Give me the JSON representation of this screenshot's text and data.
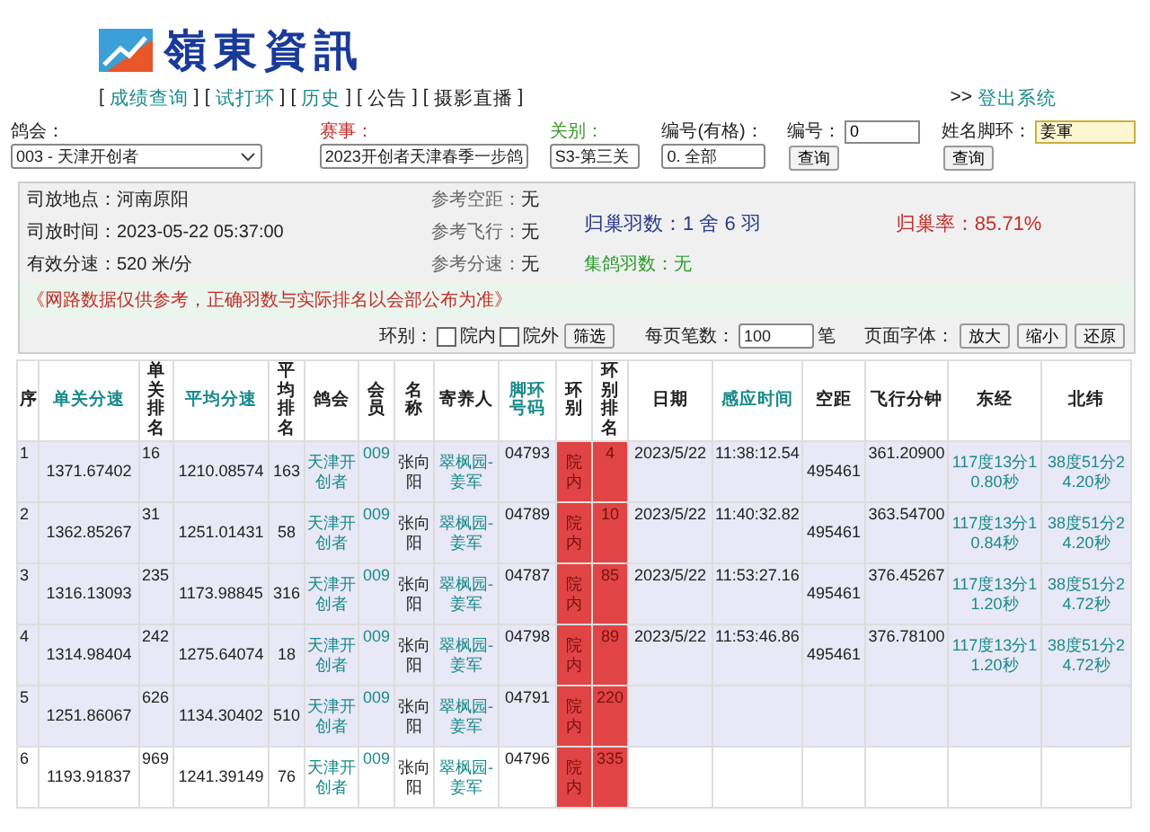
{
  "header": {
    "logo_text": "嶺東資訊"
  },
  "nav": {
    "bracket_open": "[",
    "bracket_close": "]",
    "items": [
      {
        "label": "成绩查询",
        "kind": "link"
      },
      {
        "label": "试打环",
        "kind": "link"
      },
      {
        "label": "历史",
        "kind": "link"
      },
      {
        "label": "公告",
        "kind": "text"
      },
      {
        "label": "摄影直播",
        "kind": "text"
      }
    ]
  },
  "logout": {
    "prefix": ">>",
    "label": "登出系统"
  },
  "filters": {
    "club": {
      "label": "鸽会：",
      "value": "003 - 天津开创者"
    },
    "race": {
      "label": "赛事：",
      "value": "2023开创者天津春季一步鸽"
    },
    "stage": {
      "label": "关别：",
      "value": "S3-第三关"
    },
    "group": {
      "label": "编号(有格)：",
      "value": "0. 全部"
    },
    "number": {
      "label": "编号：",
      "value": "0",
      "button": "查询"
    },
    "name_ring": {
      "label": "姓名脚环：",
      "value": "姜軍",
      "button": "查询"
    }
  },
  "info": {
    "place": {
      "label": "司放地点：",
      "value": "河南原阳"
    },
    "time": {
      "label": "司放时间：",
      "value": "2023-05-22 05:37:00"
    },
    "speed": {
      "label": "有效分速：",
      "value": "520 米/分"
    },
    "ref_distance": {
      "label": "参考空距：",
      "value": "无"
    },
    "ref_flight": {
      "label": "参考飞行：",
      "value": "无"
    },
    "ref_speed": {
      "label": "参考分速：",
      "value": "无"
    },
    "returned": {
      "label": "归巢羽数：",
      "value": "1 舍 6 羽"
    },
    "return_rate": {
      "label": "归巢率：",
      "value": "85.71%"
    },
    "collected": {
      "label": "集鸽羽数：",
      "value": "无"
    },
    "notice": "《网路数据仅供参考，正确羽数与实际排名以会部公布为准》"
  },
  "controls": {
    "ring_label": "环别：",
    "inside": {
      "label": "院内",
      "checked": false
    },
    "outside": {
      "label": "院外",
      "checked": false
    },
    "filter_button": "筛选",
    "per_page_label": "每页笔数：",
    "per_page": "100",
    "per_page_unit": "笔",
    "font_label": "页面字体：",
    "font_buttons": [
      "放大",
      "缩小",
      "还原"
    ]
  },
  "table": {
    "columns": [
      {
        "label": "序",
        "sortable": false
      },
      {
        "label": "单关分速",
        "sortable": true
      },
      {
        "label": "单关排名",
        "sortable": false
      },
      {
        "label": "平均分速",
        "sortable": true
      },
      {
        "label": "平均排名",
        "sortable": false
      },
      {
        "label": "鸽会",
        "sortable": false
      },
      {
        "label": "会员",
        "sortable": false
      },
      {
        "label": "名称",
        "sortable": false
      },
      {
        "label": "寄养人",
        "sortable": false
      },
      {
        "label": "脚环号码",
        "sortable": true
      },
      {
        "label": "环别",
        "sortable": false
      },
      {
        "label": "环别排名",
        "sortable": false
      },
      {
        "label": "日期",
        "sortable": false
      },
      {
        "label": "感应时间",
        "sortable": true
      },
      {
        "label": "空距",
        "sortable": false
      },
      {
        "label": "飞行分钟",
        "sortable": false
      },
      {
        "label": "东经",
        "sortable": false
      },
      {
        "label": "北纬",
        "sortable": false
      }
    ],
    "rows": [
      {
        "seq": "1",
        "speed": "1371.67402",
        "rank": "16",
        "avg_speed": "1210.08574",
        "avg_rank": "163",
        "club": "天津开创者",
        "member": "009",
        "name": "张向阳",
        "keeper": "翠枫园-姜军",
        "ring": "04793",
        "ring_type": "院内",
        "ring_rank": "4",
        "date": "2023/5/22",
        "time": "11:38:12.54",
        "distance": "495461",
        "minutes": "361.20900",
        "lon": "117度13分10.80秒",
        "lat": "38度51分24.20秒",
        "shaded": true
      },
      {
        "seq": "2",
        "speed": "1362.85267",
        "rank": "31",
        "avg_speed": "1251.01431",
        "avg_rank": "58",
        "club": "天津开创者",
        "member": "009",
        "name": "张向阳",
        "keeper": "翠枫园-姜军",
        "ring": "04789",
        "ring_type": "院内",
        "ring_rank": "10",
        "date": "2023/5/22",
        "time": "11:40:32.82",
        "distance": "495461",
        "minutes": "363.54700",
        "lon": "117度13分10.84秒",
        "lat": "38度51分24.20秒",
        "shaded": true
      },
      {
        "seq": "3",
        "speed": "1316.13093",
        "rank": "235",
        "avg_speed": "1173.98845",
        "avg_rank": "316",
        "club": "天津开创者",
        "member": "009",
        "name": "张向阳",
        "keeper": "翠枫园-姜军",
        "ring": "04787",
        "ring_type": "院内",
        "ring_rank": "85",
        "date": "2023/5/22",
        "time": "11:53:27.16",
        "distance": "495461",
        "minutes": "376.45267",
        "lon": "117度13分11.20秒",
        "lat": "38度51分24.72秒",
        "shaded": true
      },
      {
        "seq": "4",
        "speed": "1314.98404",
        "rank": "242",
        "avg_speed": "1275.64074",
        "avg_rank": "18",
        "club": "天津开创者",
        "member": "009",
        "name": "张向阳",
        "keeper": "翠枫园-姜军",
        "ring": "04798",
        "ring_type": "院内",
        "ring_rank": "89",
        "date": "2023/5/22",
        "time": "11:53:46.86",
        "distance": "495461",
        "minutes": "376.78100",
        "lon": "117度13分11.20秒",
        "lat": "38度51分24.72秒",
        "shaded": true
      },
      {
        "seq": "5",
        "speed": "1251.86067",
        "rank": "626",
        "avg_speed": "1134.30402",
        "avg_rank": "510",
        "club": "天津开创者",
        "member": "009",
        "name": "张向阳",
        "keeper": "翠枫园-姜军",
        "ring": "04791",
        "ring_type": "院内",
        "ring_rank": "220",
        "shaded": true
      },
      {
        "seq": "6",
        "speed": "1193.91837",
        "rank": "969",
        "avg_speed": "1241.39149",
        "avg_rank": "76",
        "club": "天津开创者",
        "member": "009",
        "name": "张向阳",
        "keeper": "翠枫园-姜军",
        "ring": "04796",
        "ring_type": "院内",
        "ring_rank": "335",
        "shaded": false
      }
    ]
  }
}
